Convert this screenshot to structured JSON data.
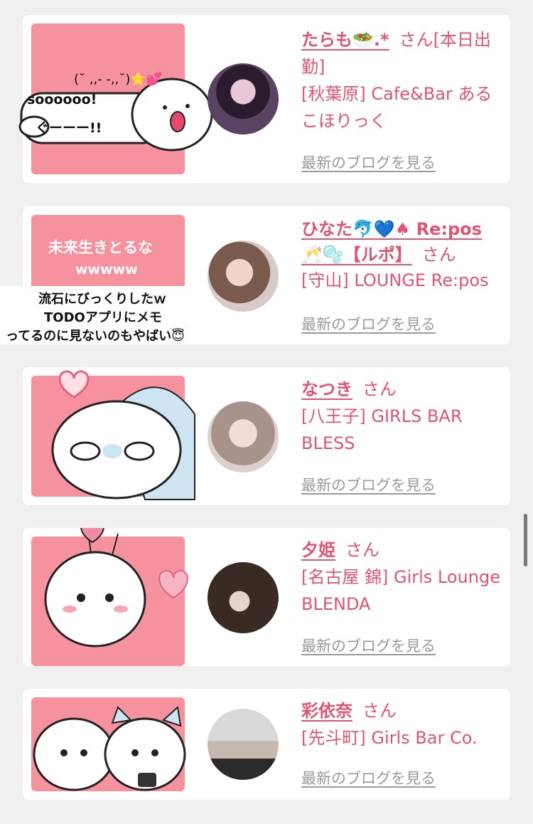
{
  "cards": [
    {
      "name": "たらも🥗.*",
      "honorific": "さん",
      "status": "[本日出勤]",
      "shop": "[秋葉原] Cafe&Bar あるこほりっく",
      "blog_link": "最新のブログを見る",
      "thumb_caption": "soooooo!",
      "thumb_caption2": "(˘ ,,- -,,˘)⭐💕",
      "thumb_caption3": "ぐーーー!!"
    },
    {
      "name": "ひなた🐬💙♠ Re:pos 🥂🫧【ルポ】",
      "honorific": "さん",
      "shop": "[守山] LOUNGE Re:pos",
      "blog_link": "最新のブログを見る",
      "thumb_title": "未来生きとるな",
      "thumb_title2": "wwwww",
      "thumb_caption": "流石にびっくりしたｗ",
      "thumb_caption2": "TODOアプリにメモ",
      "thumb_caption3": "ってるのに見ないのもやばい😇"
    },
    {
      "name": "なつき",
      "honorific": "さん",
      "shop": "[八王子] GIRLS BAR BLESS",
      "blog_link": "最新のブログを見る"
    },
    {
      "name": "夕姫",
      "honorific": "さん",
      "shop": "[名古屋 錦] Girls Lounge BLENDA",
      "blog_link": "最新のブログを見る"
    },
    {
      "name": "彩依奈",
      "honorific": "さん",
      "shop": "[先斗町] Girls Bar Co.",
      "blog_link": "最新のブログを見る"
    }
  ],
  "colors": {
    "accent_pink": "#e05474",
    "thumb_pink": "#f6919e",
    "link_gray": "#9a9a9a",
    "background": "#f0f0f0"
  }
}
